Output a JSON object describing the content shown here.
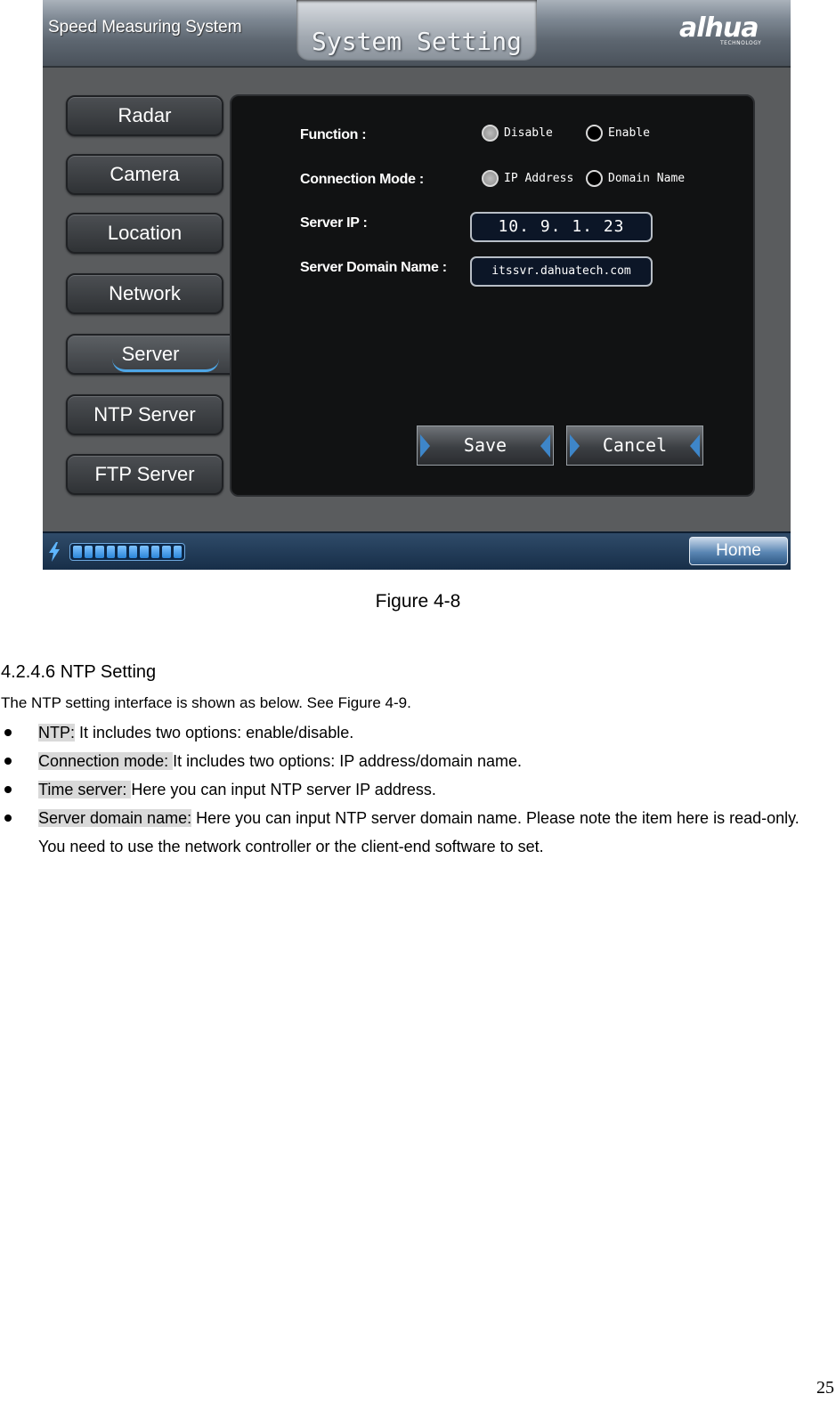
{
  "ui": {
    "app_name": "Speed Measuring System",
    "screen_title": "System Setting",
    "brand": {
      "logo_text": "alhua",
      "logo_subtext": "TECHNOLOGY"
    },
    "nav_items": [
      {
        "label": "Radar",
        "active": false
      },
      {
        "label": "Camera",
        "active": false
      },
      {
        "label": "Location",
        "active": false
      },
      {
        "label": "Network",
        "active": false
      },
      {
        "label": "Server",
        "active": true
      },
      {
        "label": "NTP Server",
        "active": false
      },
      {
        "label": "FTP Server",
        "active": false
      }
    ],
    "form": {
      "function": {
        "label": "Function :",
        "options": [
          {
            "label": "Disable",
            "selected": true
          },
          {
            "label": "Enable",
            "selected": false
          }
        ]
      },
      "connection_mode": {
        "label": "Connection Mode :",
        "options": [
          {
            "label": "IP Address",
            "selected": true
          },
          {
            "label": "Domain Name",
            "selected": false
          }
        ]
      },
      "server_ip": {
        "label": "Server IP :",
        "value": "10.  9.  1. 23"
      },
      "server_domain": {
        "label": "Server Domain Name :",
        "value": "itssvr.dahuatech.com"
      },
      "save_label": "Save",
      "cancel_label": "Cancel"
    },
    "status_bar": {
      "progress_fraction": 1.0,
      "home_label": "Home"
    },
    "colors": {
      "accent": "#3e86c9",
      "panel": "#111213",
      "chrome": "#5a5c5e"
    }
  },
  "document": {
    "figure_caption": "Figure 4-8",
    "section_heading": "4.2.4.6  NTP Setting",
    "intro": "The NTP setting interface is shown as below. See Figure 4-9.",
    "bullets": [
      {
        "term": "NTP:",
        "text": " It includes two options: enable/disable."
      },
      {
        "term": "Connection mode: ",
        "text": "It includes two options: IP address/domain name."
      },
      {
        "term": "Time server: ",
        "text": "Here you can input NTP server IP address."
      },
      {
        "term": "Server domain name:",
        "text": " Here you can input NTP server domain name. Please note the item here  is read-only. You need to use the network controller or the client-end software to set."
      }
    ],
    "page_number": "25"
  }
}
